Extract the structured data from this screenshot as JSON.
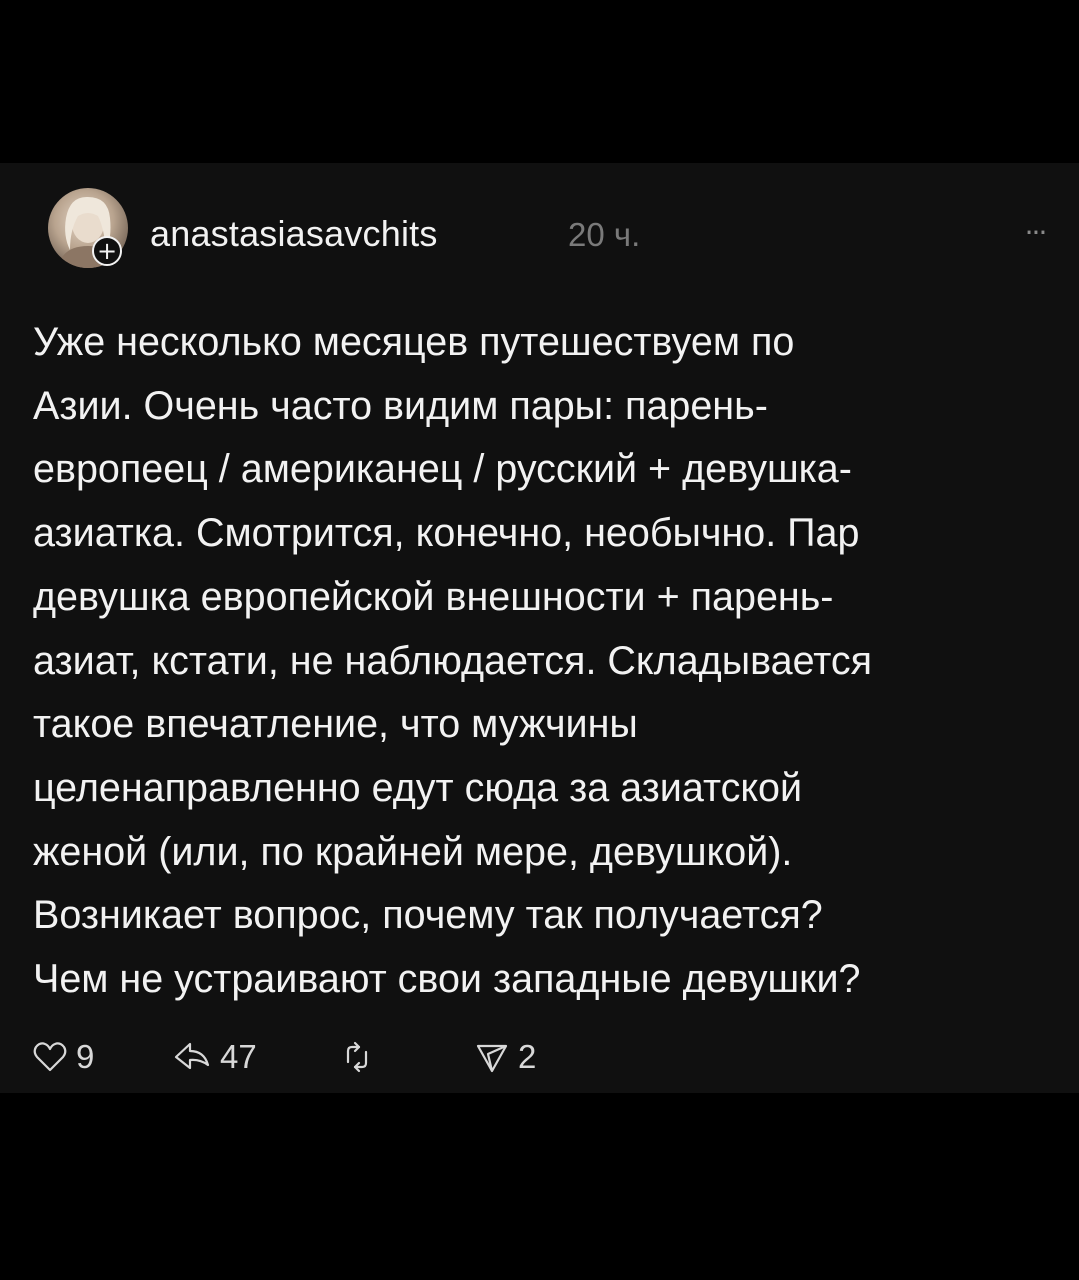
{
  "post": {
    "username": "anastasiasavchits",
    "timestamp": "20 ч.",
    "more_label": "...",
    "follow_badge": "+",
    "text_lines": [
      "Уже несколько месяцев путешествуем по",
      "Азии. Очень часто видим пары: парень-",
      "европеец / американец / русский + девушка-",
      "азиатка. Смотрится, конечно, необычно. Пар",
      "девушка европейской внешности + парень-",
      "азиат, кстати, не наблюдается. Складывается",
      "такое впечатление, что мужчины",
      "целенаправленно едут сюда за азиатской",
      "женой (или, по крайней мере, девушкой).",
      "Возникает вопрос, почему так получается?",
      "Чем не устраивают свои западные девушки?"
    ],
    "actions": {
      "like_count": "9",
      "comment_count": "47",
      "repost_count": "",
      "share_count": "2"
    }
  },
  "colors": {
    "background": "#000000",
    "card": "#101010",
    "text": "#f2f2f2",
    "muted": "#7a7a7a"
  },
  "icons": {
    "like": "heart-icon",
    "comment": "comment-icon",
    "repost": "repost-icon",
    "share": "send-icon",
    "more": "more-icon",
    "follow": "plus-icon"
  }
}
